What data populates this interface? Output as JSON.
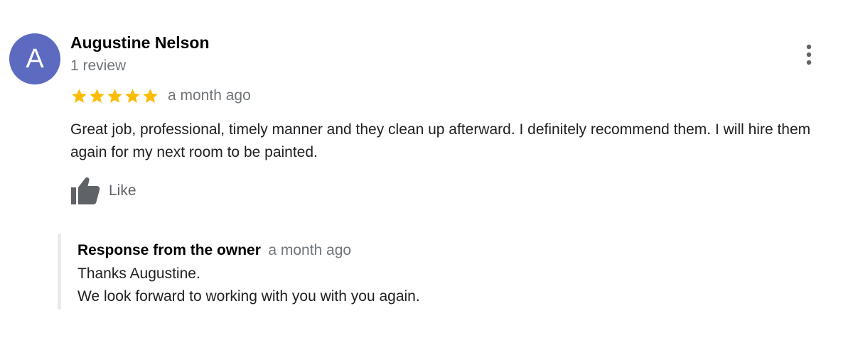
{
  "review": {
    "author": {
      "name": "Augustine Nelson",
      "initial": "A",
      "review_count": "1 review",
      "avatar_color": "#5c6bc0"
    },
    "rating": {
      "stars": 5,
      "max_stars": 5,
      "star_color": "#fbbc04"
    },
    "time": "a month ago",
    "text": "Great job, professional, timely manner and they clean up afterward. I definitely recommend them. I will hire them again for my next room to be painted.",
    "like": {
      "label": "Like",
      "icon": "thumbs-up-icon"
    },
    "more_icon": "more-vert-icon"
  },
  "owner_response": {
    "title": "Response from the owner",
    "time": "a month ago",
    "lines": [
      "Thanks Augustine.",
      "We look forward to working with you with you again."
    ]
  }
}
